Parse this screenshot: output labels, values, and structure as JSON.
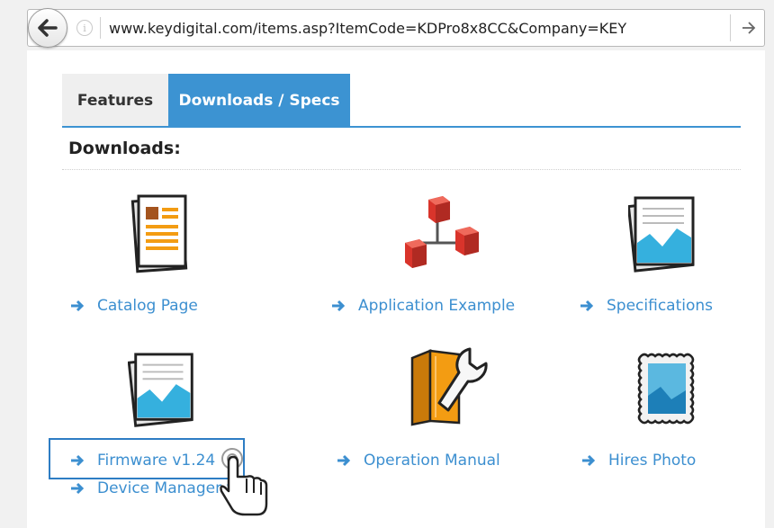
{
  "browser": {
    "url": "www.keydigital.com/items.asp?ItemCode=KDPro8x8CC&Company=KEY",
    "icons": {
      "back": "back-arrow-icon",
      "info": "info-icon",
      "go": "go-arrow-icon"
    }
  },
  "tabs": [
    {
      "label": "Features",
      "active": false
    },
    {
      "label": "Downloads / Specs",
      "active": true
    }
  ],
  "section_title": "Downloads:",
  "downloads": [
    {
      "label": "Catalog Page",
      "icon": "document-icon"
    },
    {
      "label": "Application Example",
      "icon": "network-diagram-icon"
    },
    {
      "label": "Specifications",
      "icon": "chart-sheet-icon"
    },
    {
      "label": "Firmware v1.24",
      "icon": "chart-sheet-icon",
      "highlighted": true
    },
    {
      "label": "Operation Manual",
      "icon": "manual-wrench-icon"
    },
    {
      "label": "Hires Photo",
      "icon": "photo-stamp-icon"
    },
    {
      "label": "Device Manager v1.2",
      "icon": null
    }
  ],
  "colors": {
    "accent": "#3c93d2",
    "link": "#3c8fd0",
    "tab_inactive": "#efefef",
    "orange": "#f39c12",
    "red": "#e74c3c"
  }
}
